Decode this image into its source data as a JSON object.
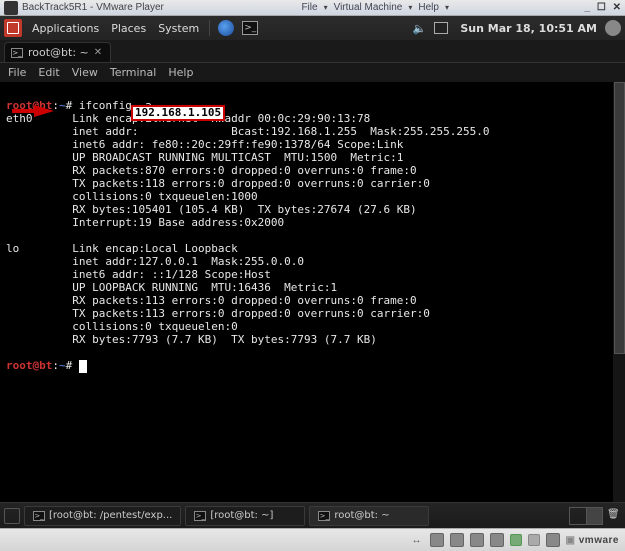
{
  "vmware": {
    "title": "BackTrack5R1 - VMware Player",
    "menus": {
      "file": "File",
      "vm": "Virtual Machine",
      "help": "Help"
    },
    "footer_logo": "vmware"
  },
  "gnome": {
    "apps": "Applications",
    "places": "Places",
    "system": "System",
    "clock": "Sun Mar 18, 10:51 AM"
  },
  "tab": {
    "title": "root@bt: ~"
  },
  "term_menu": {
    "file": "File",
    "edit": "Edit",
    "view": "View",
    "terminal": "Terminal",
    "help": "Help"
  },
  "prompt": {
    "user_host": "root@bt",
    "path": "~",
    "hash": "#"
  },
  "cmd1": "ifconfig -a",
  "ifconfig": {
    "eth0_lines": [
      "eth0      Link encap:Ethernet  HWaddr 00:0c:29:90:13:78",
      "          inet addr:              Bcast:192.168.1.255  Mask:255.255.255.0",
      "          inet6 addr: fe80::20c:29ff:fe90:1378/64 Scope:Link",
      "          UP BROADCAST RUNNING MULTICAST  MTU:1500  Metric:1",
      "          RX packets:870 errors:0 dropped:0 overruns:0 frame:0",
      "          TX packets:118 errors:0 dropped:0 overruns:0 carrier:0",
      "          collisions:0 txqueuelen:1000",
      "          RX bytes:105401 (105.4 KB)  TX bytes:27674 (27.6 KB)",
      "          Interrupt:19 Base address:0x2000"
    ],
    "highlighted_ip": "192.168.1.105",
    "lo_lines": [
      "lo        Link encap:Local Loopback",
      "          inet addr:127.0.0.1  Mask:255.0.0.0",
      "          inet6 addr: ::1/128 Scope:Host",
      "          UP LOOPBACK RUNNING  MTU:16436  Metric:1",
      "          RX packets:113 errors:0 dropped:0 overruns:0 frame:0",
      "          TX packets:113 errors:0 dropped:0 overruns:0 carrier:0",
      "          collisions:0 txqueuelen:0",
      "          RX bytes:7793 (7.7 KB)  TX bytes:7793 (7.7 KB)"
    ]
  },
  "taskbar": {
    "t1": "[root@bt: /pentest/exp...",
    "t2": "[root@bt: ~]",
    "t3": "root@bt: ~"
  }
}
